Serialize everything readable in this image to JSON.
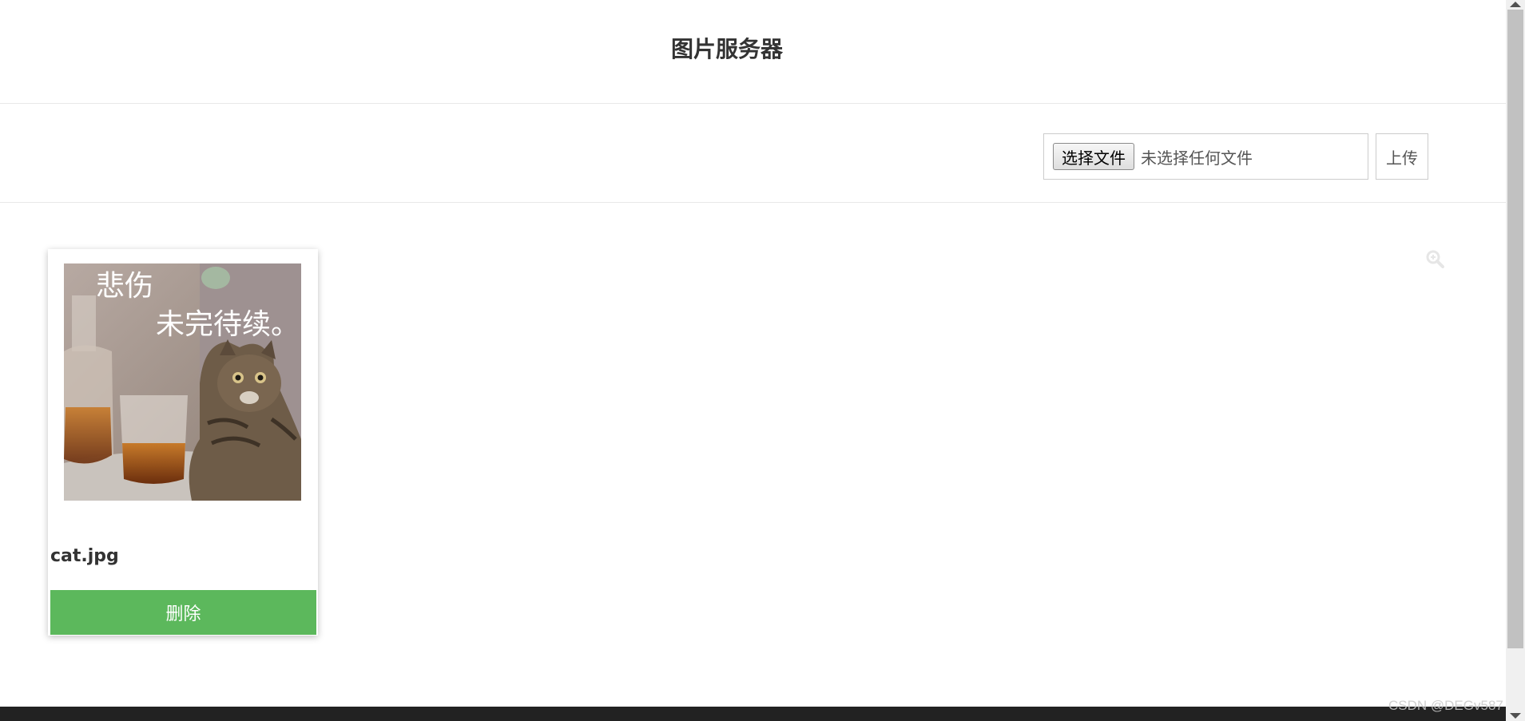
{
  "header": {
    "title": "图片服务器"
  },
  "toolbar": {
    "choose_file_label": "选择文件",
    "file_status": "未选择任何文件",
    "upload_label": "上传"
  },
  "gallery": {
    "items": [
      {
        "image_caption_line1": "悲伤",
        "image_caption_line2": "未完待续。",
        "filename": "cat.jpg",
        "delete_label": "删除"
      }
    ]
  },
  "watermark": "CSDN @DEGv587",
  "colors": {
    "delete_button": "#5cb85c",
    "footer_bar": "#222222",
    "border": "#cccccc"
  },
  "icons": {
    "zoom": "zoom-in-icon"
  }
}
